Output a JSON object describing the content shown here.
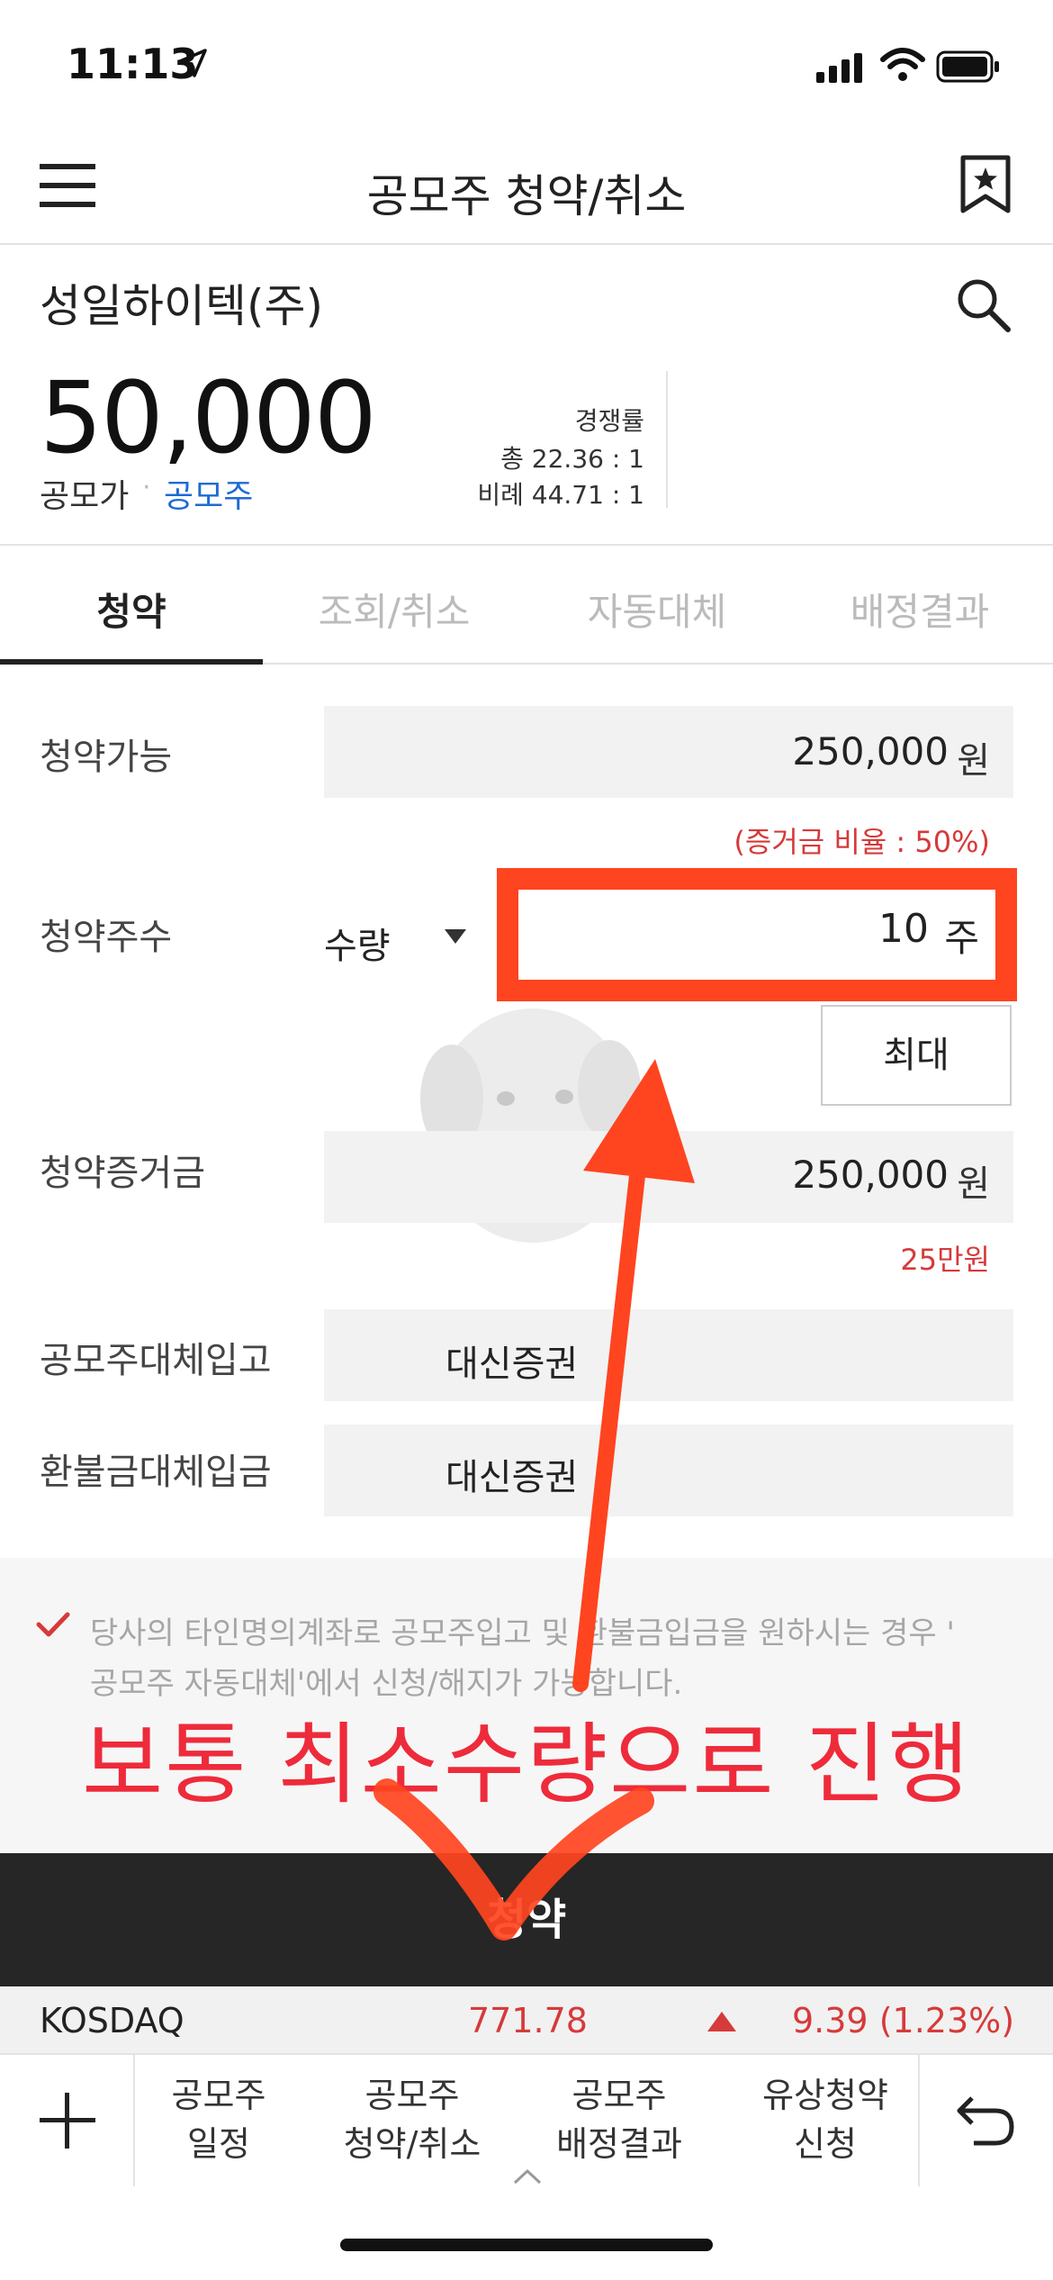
{
  "status": {
    "time": "11:13"
  },
  "nav": {
    "title": "공모주 청약/취소"
  },
  "stock": {
    "name": "성일하이텍(주)",
    "price": "50,000",
    "price_type": "공모가",
    "stock_type": "공모주",
    "competition_label": "경쟁률",
    "competition_total": "총 22.36 : 1",
    "competition_proportional": "비례 44.71 : 1"
  },
  "tabs": [
    {
      "label": "청약",
      "active": true
    },
    {
      "label": "조회/취소",
      "active": false
    },
    {
      "label": "자동대체",
      "active": false
    },
    {
      "label": "배정결과",
      "active": false
    }
  ],
  "form": {
    "available_label": "청약가능",
    "available_value": "250,000",
    "available_unit": "원",
    "margin_ratio": "(증거금 비율 : 50%)",
    "qty_label": "청약주수",
    "qty_type": "수량",
    "qty_value": "10",
    "qty_unit": "주",
    "max_button": "최대",
    "deposit_label": "청약증거금",
    "deposit_value": "250,000",
    "deposit_unit": "원",
    "deposit_korean": "25만원",
    "ipo_transfer_label": "공모주대체입고",
    "ipo_transfer_value": "대신증권",
    "refund_label": "환불금대체입금",
    "refund_value": "대신증권"
  },
  "notice": {
    "line1": "당사의 타인명의계좌로 공모주입고 및 환불금입금을 원하시는 경우 '",
    "line2": "공모주 자동대체'에서 신청/해지가 가능합니다."
  },
  "annotation": "보통 최소수량으로 진행",
  "submit_label": "청약",
  "ticker": {
    "name": "KOSDAQ",
    "value": "771.78",
    "change": "9.39 (1.23%)"
  },
  "bottom": {
    "items": [
      {
        "line1": "공모주",
        "line2": "일정"
      },
      {
        "line1": "공모주",
        "line2": "청약/취소"
      },
      {
        "line1": "공모주",
        "line2": "배정결과"
      },
      {
        "line1": "유상청약",
        "line2": "신청"
      }
    ]
  },
  "colors": {
    "accent_red": "#ff4420",
    "link_blue": "#1e6ad6",
    "up_red": "#d63a3a"
  }
}
